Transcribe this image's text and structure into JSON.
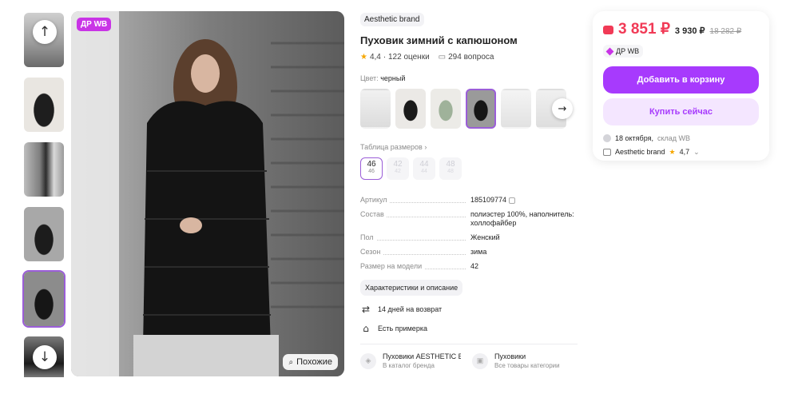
{
  "gallery": {
    "badge": "ДР WB",
    "similar_label": "Похожие",
    "thumbs_count": 6,
    "active_thumb": 4
  },
  "product": {
    "brand": "Aesthetic brand",
    "title": "Пуховик зимний с капюшоном",
    "rating": "4,4",
    "reviews": "· 122 оценки",
    "questions": "294 вопроса",
    "color_label": "Цвет:",
    "color_value": "черный",
    "size_table_link": "Таблица размеров",
    "sizes": [
      {
        "ru": "46",
        "eu": "46",
        "active": true
      },
      {
        "ru": "42",
        "eu": "42",
        "active": false
      },
      {
        "ru": "44",
        "eu": "44",
        "active": false
      },
      {
        "ru": "48",
        "eu": "48",
        "active": false
      }
    ],
    "specs": [
      {
        "key": "Артикул",
        "value": "185109774"
      },
      {
        "key": "Состав",
        "value": "полиэстер 100%, наполнитель: холлофайбер"
      },
      {
        "key": "Пол",
        "value": "Женский"
      },
      {
        "key": "Сезон",
        "value": "зима"
      },
      {
        "key": "Размер на модели",
        "value": "42"
      }
    ],
    "chars_button": "Характеристики и описание",
    "features": [
      {
        "icon": "return-icon",
        "label": "14 дней на возврат"
      },
      {
        "icon": "hanger-icon",
        "label": "Есть примерка"
      }
    ],
    "categories": [
      {
        "name": "Пуховики AESTHETIC BRAND",
        "sub": "В каталог бренда"
      },
      {
        "name": "Пуховики",
        "sub": "Все товары категории"
      }
    ]
  },
  "buy": {
    "price": "3 851 ₽",
    "price_alt": "3 930 ₽",
    "price_old": "18 282 ₽",
    "dr_badge": "ДР WB",
    "cart_button": "Добавить в корзину",
    "buy_button": "Купить сейчас",
    "delivery_date": "18 октября,",
    "delivery_warehouse": "склад WB",
    "seller": "Aesthetic brand",
    "seller_rating": "4,7",
    "colors": {
      "accent": "#a73afd",
      "price": "#f13a56"
    }
  }
}
